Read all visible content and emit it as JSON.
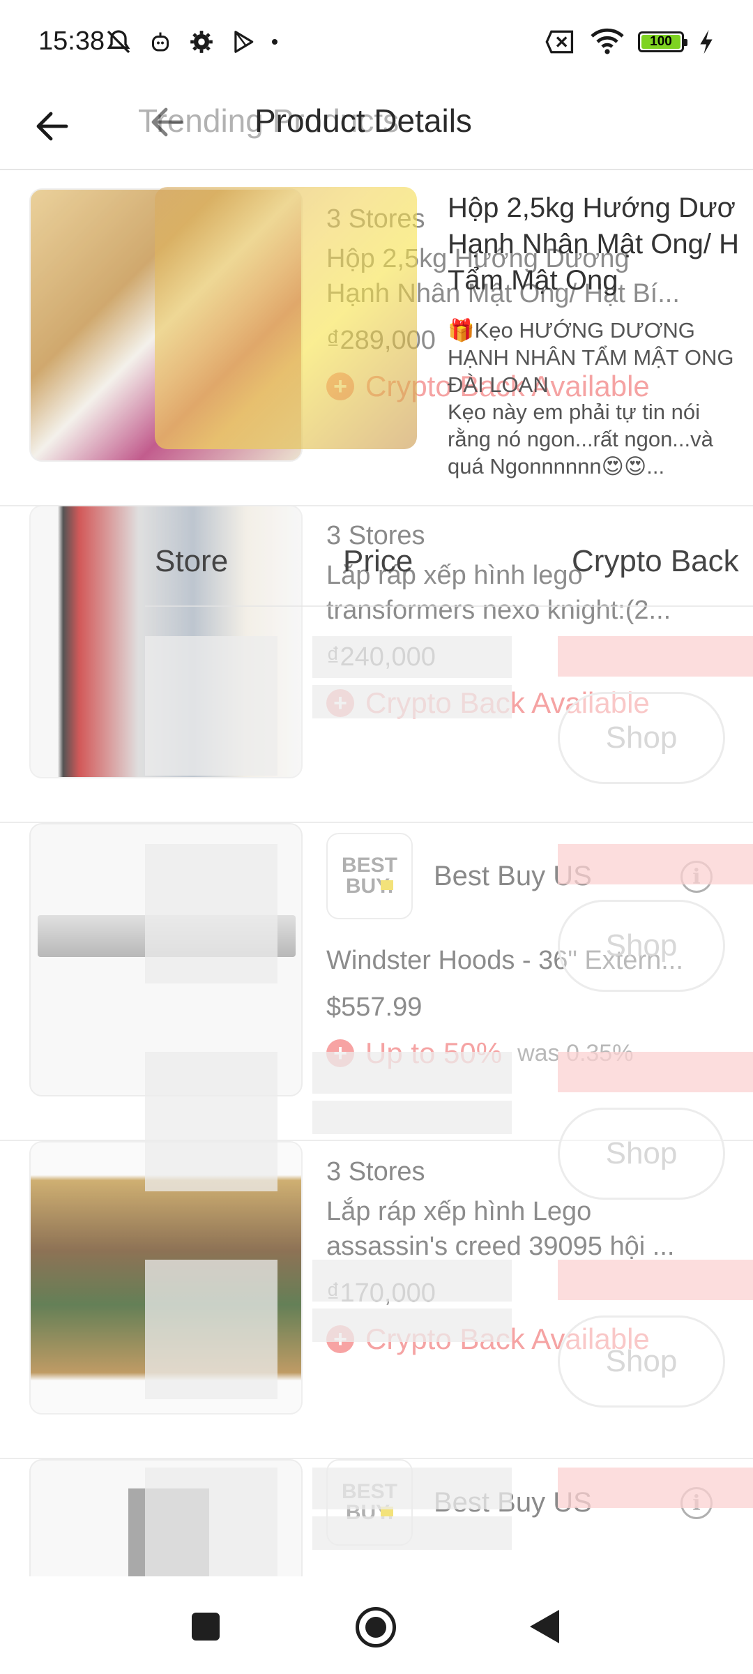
{
  "status_bar": {
    "time": "15:38",
    "battery": "100",
    "icons_left": [
      "mute-bell-icon",
      "robot-icon",
      "gear-icon",
      "play-store-icon",
      "dot-icon"
    ],
    "icons_right": [
      "no-sim-icon",
      "wifi-icon",
      "battery-icon",
      "charging-icon"
    ]
  },
  "toolbar": {
    "ghost_title": "Trending Products",
    "title": "Product Details"
  },
  "products": [
    {
      "stores": "3 Stores",
      "name_line1": "Hộp 2,5kg Hướng Dương",
      "name_line2": "Hạnh Nhân Mật Ong/ Hạt Bí...",
      "price": "₫289,000",
      "cashback": "Crypto Back Available"
    },
    {
      "stores": "3 Stores",
      "name_line1": "Lắp ráp xếp hình lego",
      "name_line2": "transformers nexo knight:(2...",
      "price": "₫240,000",
      "cashback": "Crypto Back Available"
    },
    {
      "store_name": "Best Buy US",
      "logo_line1": "BEST",
      "logo_line2": "BUY.",
      "name_line1": "Windster Hoods - 36\" Extern...",
      "price": "$557.99",
      "cashback": "Up to 50%",
      "cashback_note": "was 0.35%"
    },
    {
      "stores": "3 Stores",
      "name_line1": "Lắp ráp xếp hình Lego",
      "name_line2": "assassin's creed 39095 hội ...",
      "price": "₫170,000",
      "cashback": "Crypto Back Available"
    },
    {
      "store_name": "Best Buy US",
      "logo_line1": "BEST",
      "logo_line2": "BUY."
    }
  ],
  "detail_overlay": {
    "product_title_lines": [
      "Hộp 2,5kg Hướng Dươ",
      "Hạnh Nhân Mật Ong/ H",
      "Tẩm Mật Ong"
    ],
    "description_lines": [
      "🎁Kẹo HƯỚNG DƯƠNG",
      "HẠNH NHÂN TẨM MẬT ONG",
      "ĐÀI LOAN",
      "Kẹo này em phải tự tin nói",
      "rằng nó ngon...rất ngon...và",
      "quá Ngonnnnnn😍😍..."
    ],
    "table_headers": {
      "store": "Store",
      "price": "Price",
      "crypto_back": "Crypto Back"
    },
    "shop_label": "Shop"
  },
  "nav": {
    "icons": [
      "recent-apps-icon",
      "home-icon",
      "back-icon"
    ]
  }
}
